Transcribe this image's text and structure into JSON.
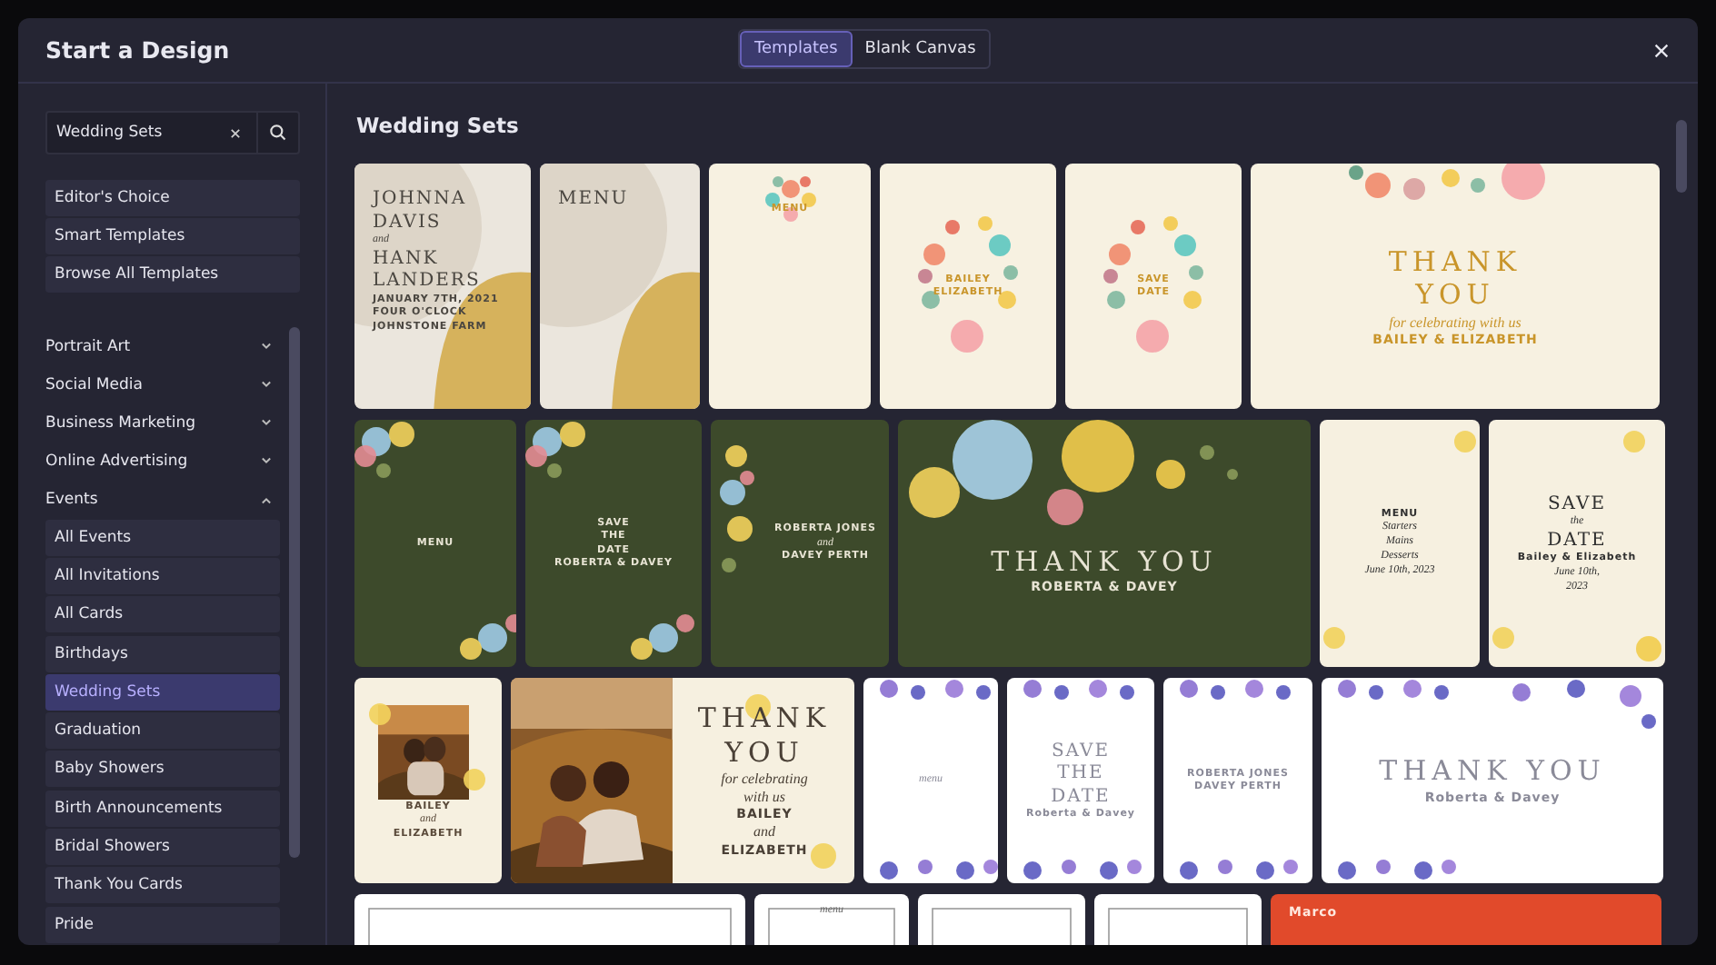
{
  "window": {
    "title": "Start a Design"
  },
  "tabs": [
    {
      "label": "Templates",
      "selected": true
    },
    {
      "label": "Blank Canvas",
      "selected": false
    }
  ],
  "sidebar": {
    "search": {
      "value": "Wedding Sets"
    },
    "shortcuts": [
      "Editor's Choice",
      "Smart Templates",
      "Browse All Templates"
    ],
    "categories": [
      {
        "label": "Portrait Art",
        "expanded": false
      },
      {
        "label": "Social Media",
        "expanded": false
      },
      {
        "label": "Business Marketing",
        "expanded": false
      },
      {
        "label": "Online Advertising",
        "expanded": false
      },
      {
        "label": "Events",
        "expanded": true,
        "children": [
          {
            "label": "All Events",
            "selected": false
          },
          {
            "label": "All Invitations",
            "selected": false
          },
          {
            "label": "All Cards",
            "selected": false
          },
          {
            "label": "Birthdays",
            "selected": false
          },
          {
            "label": "Wedding Sets",
            "selected": true
          },
          {
            "label": "Graduation",
            "selected": false
          },
          {
            "label": "Baby Showers",
            "selected": false
          },
          {
            "label": "Birth Announcements",
            "selected": false
          },
          {
            "label": "Bridal Showers",
            "selected": false
          },
          {
            "label": "Thank You Cards",
            "selected": false
          },
          {
            "label": "Pride",
            "selected": false
          }
        ]
      }
    ]
  },
  "content": {
    "heading": "Wedding Sets",
    "templates": [
      {
        "kind": "blob",
        "lines": [
          {
            "text": "JOHNNA",
            "kind": "title"
          },
          {
            "text": "DAVIS",
            "kind": "title"
          },
          {
            "text": "and",
            "kind": "script"
          },
          {
            "text": "HANK",
            "kind": "title"
          },
          {
            "text": "LANDERS",
            "kind": "title"
          },
          {
            "text": "JANUARY 7TH, 2021",
            "kind": "small"
          },
          {
            "text": "FOUR O'CLOCK",
            "kind": "small"
          },
          {
            "text": "JOHNSTONE FARM",
            "kind": "small"
          }
        ]
      },
      {
        "kind": "blob",
        "lines": [
          {
            "text": "MENU",
            "kind": "title"
          }
        ]
      },
      {
        "kind": "wreath-top",
        "lines": [
          {
            "text": "MENU",
            "kind": "small"
          }
        ]
      },
      {
        "kind": "wreath",
        "lines": [
          {
            "text": "BAILEY",
            "kind": "small"
          },
          {
            "text": "ELIZABETH",
            "kind": "small"
          }
        ]
      },
      {
        "kind": "wreath",
        "lines": [
          {
            "text": "SAVE",
            "kind": "small"
          },
          {
            "text": "DATE",
            "kind": "small"
          }
        ]
      },
      {
        "kind": "garland",
        "lines": [
          {
            "text": "THANK",
            "kind": "title"
          },
          {
            "text": "YOU",
            "kind": "title"
          },
          {
            "text": "for celebrating with us",
            "kind": "script"
          },
          {
            "text": "BAILEY & ELIZABETH",
            "kind": "small"
          }
        ]
      },
      {
        "kind": "watercolor",
        "lines": [
          {
            "text": "MENU",
            "kind": "small"
          }
        ]
      },
      {
        "kind": "watercolor",
        "lines": [
          {
            "text": "SAVE",
            "kind": "small"
          },
          {
            "text": "THE",
            "kind": "small"
          },
          {
            "text": "DATE",
            "kind": "small"
          },
          {
            "text": "ROBERTA & DAVEY",
            "kind": "small"
          }
        ]
      },
      {
        "kind": "watercolor-side",
        "lines": [
          {
            "text": "ROBERTA JONES",
            "kind": "small"
          },
          {
            "text": "and",
            "kind": "script"
          },
          {
            "text": "DAVEY PERTH",
            "kind": "small"
          }
        ]
      },
      {
        "kind": "watercolor-large",
        "lines": [
          {
            "text": "THANK YOU",
            "kind": "title"
          },
          {
            "text": "ROBERTA & DAVEY",
            "kind": "small"
          }
        ]
      },
      {
        "kind": "sprig",
        "lines": [
          {
            "text": "MENU",
            "kind": "small"
          },
          {
            "text": "Starters",
            "kind": "script"
          },
          {
            "text": "Mains",
            "kind": "script"
          },
          {
            "text": "Desserts",
            "kind": "script"
          },
          {
            "text": "June 10th, 2023",
            "kind": "script"
          }
        ]
      },
      {
        "kind": "sprig",
        "lines": [
          {
            "text": "SAVE",
            "kind": "title"
          },
          {
            "text": "the",
            "kind": "script"
          },
          {
            "text": "DATE",
            "kind": "title"
          },
          {
            "text": "Bailey & Elizabeth",
            "kind": "small"
          },
          {
            "text": "June 10th,",
            "kind": "script"
          },
          {
            "text": "2023",
            "kind": "script"
          }
        ]
      },
      {
        "kind": "photo-inset",
        "lines": [
          {
            "text": "BAILEY",
            "kind": "small"
          },
          {
            "text": "and",
            "kind": "script"
          },
          {
            "text": "ELIZABETH",
            "kind": "small"
          }
        ]
      },
      {
        "kind": "photo-half",
        "lines": [
          {
            "text": "THANK",
            "kind": "title"
          },
          {
            "text": "YOU",
            "kind": "title"
          },
          {
            "text": "for celebrating",
            "kind": "script"
          },
          {
            "text": "with us",
            "kind": "script"
          },
          {
            "text": "BAILEY",
            "kind": "small"
          },
          {
            "text": "and",
            "kind": "script"
          },
          {
            "text": "ELIZABETH",
            "kind": "small"
          }
        ]
      },
      {
        "kind": "roses",
        "lines": [
          {
            "text": "menu",
            "kind": "script"
          }
        ]
      },
      {
        "kind": "roses",
        "lines": [
          {
            "text": "SAVE",
            "kind": "title"
          },
          {
            "text": "THE",
            "kind": "title"
          },
          {
            "text": "DATE",
            "kind": "title"
          },
          {
            "text": "Roberta & Davey",
            "kind": "small"
          }
        ]
      },
      {
        "kind": "roses",
        "lines": [
          {
            "text": "ROBERTA JONES",
            "kind": "small"
          },
          {
            "text": "DAVEY PERTH",
            "kind": "small"
          }
        ]
      },
      {
        "kind": "roses",
        "lines": [
          {
            "text": "THANK YOU",
            "kind": "title"
          },
          {
            "text": "Roberta & Davey",
            "kind": "small"
          }
        ]
      },
      {
        "kind": "frame"
      },
      {
        "kind": "frame",
        "lines": [
          {
            "text": "menu",
            "kind": "script"
          }
        ]
      },
      {
        "kind": "frame"
      },
      {
        "kind": "frame"
      },
      {
        "kind": "solid",
        "lines": [
          {
            "text": "Marco",
            "kind": "small"
          }
        ]
      }
    ]
  }
}
